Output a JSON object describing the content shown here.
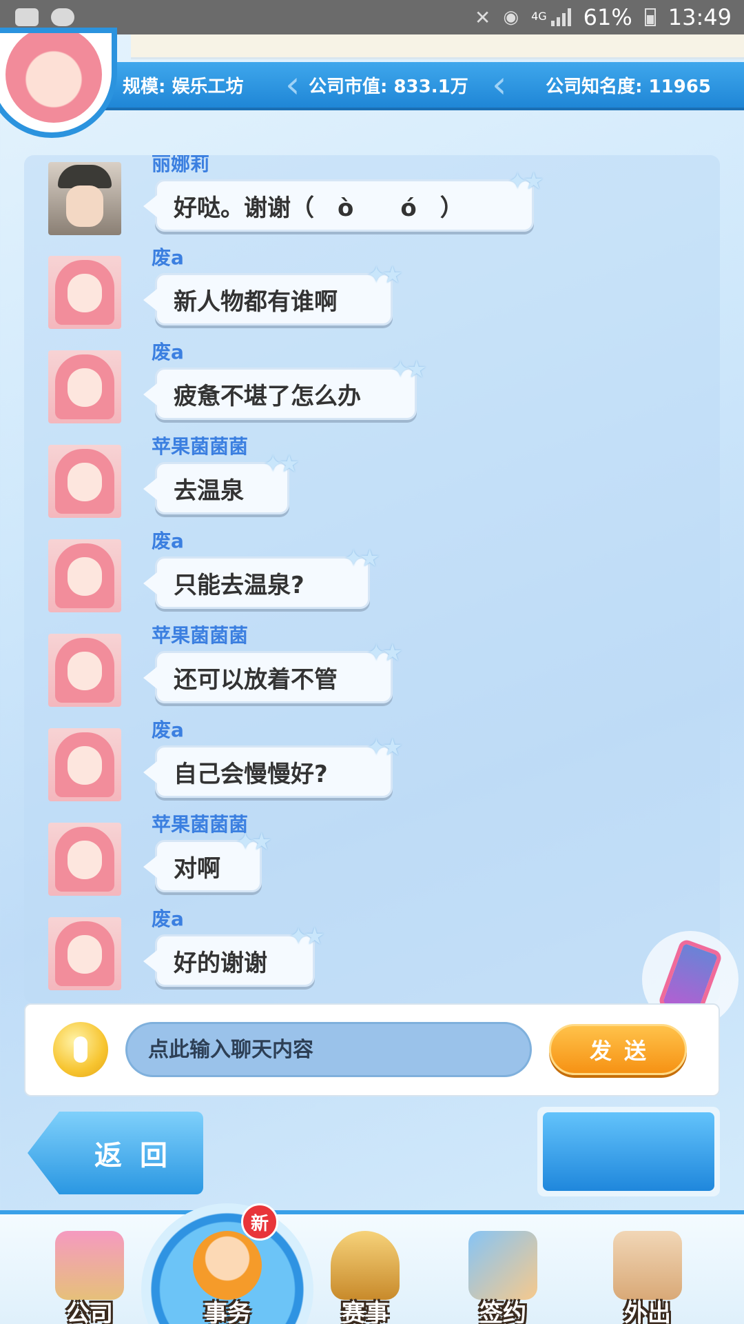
{
  "status_bar": {
    "battery": "61%",
    "time": "13:49",
    "network": "4G"
  },
  "header": {
    "scale": "规模: 娱乐工坊",
    "market_value": "公司市值: 833.1万",
    "fame": "公司知名度: 11965"
  },
  "messages": [
    {
      "name": "丽娜莉",
      "text": "好哒。谢谢（　ò　　ó　）",
      "avatar": "boy"
    },
    {
      "name": "废a",
      "text": "新人物都有谁啊",
      "avatar": "girl"
    },
    {
      "name": "废a",
      "text": "疲惫不堪了怎么办",
      "avatar": "girl"
    },
    {
      "name": "苹果菌菌菌",
      "text": "去温泉",
      "avatar": "girl"
    },
    {
      "name": "废a",
      "text": "只能去温泉?",
      "avatar": "girl"
    },
    {
      "name": "苹果菌菌菌",
      "text": "还可以放着不管",
      "avatar": "girl"
    },
    {
      "name": "废a",
      "text": "自己会慢慢好?",
      "avatar": "girl"
    },
    {
      "name": "苹果菌菌菌",
      "text": "对啊",
      "avatar": "girl"
    },
    {
      "name": "废a",
      "text": "好的谢谢",
      "avatar": "girl"
    }
  ],
  "input": {
    "placeholder": "点此输入聊天内容",
    "send_label": "发送"
  },
  "back_label": "返回",
  "nav": {
    "company": "公司",
    "affairs": "事务",
    "contest": "赛事",
    "sign": "签约",
    "outing": "外出",
    "new_badge": "新"
  },
  "colors": {
    "accent": "#2b93de",
    "name": "#3b7fe0",
    "send": "#f69214"
  }
}
